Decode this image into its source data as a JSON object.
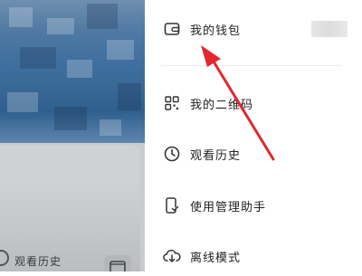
{
  "backdrop": {
    "history_label": "观看历史"
  },
  "menu": {
    "items": [
      {
        "label": "我的钱包",
        "icon": "wallet-icon"
      },
      {
        "label": "我的二维码",
        "icon": "qrcode-icon"
      },
      {
        "label": "观看历史",
        "icon": "clock-icon"
      },
      {
        "label": "使用管理助手",
        "icon": "phone-check-icon"
      },
      {
        "label": "离线模式",
        "icon": "cloud-download-icon"
      }
    ]
  },
  "annotation": {
    "arrow_color": "#e0282e"
  }
}
